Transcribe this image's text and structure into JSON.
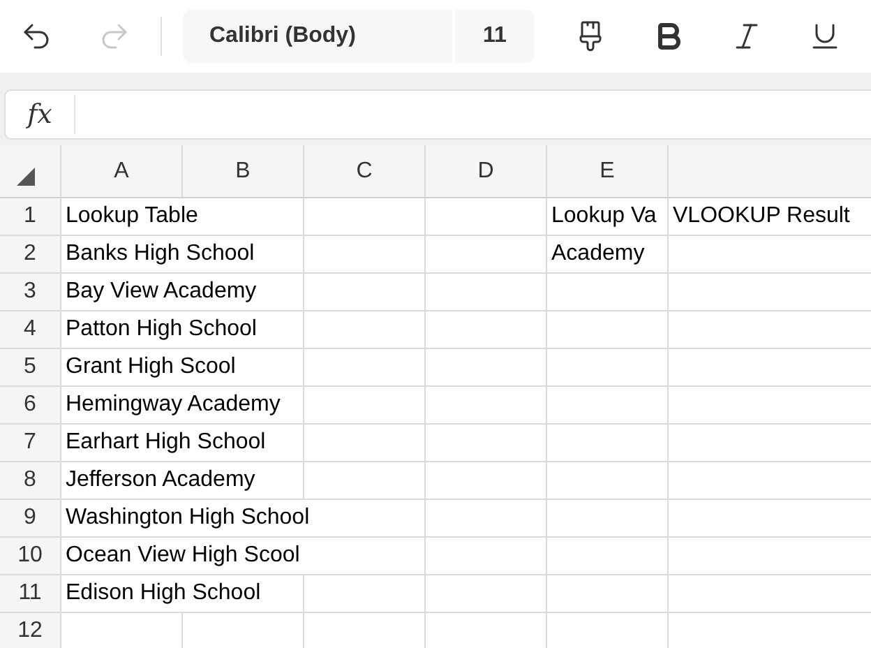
{
  "toolbar": {
    "undo": {
      "disabled": false
    },
    "redo": {
      "disabled": true
    },
    "font_name": "Calibri (Body)",
    "font_size": "11"
  },
  "formula_bar": {
    "label": "fx"
  },
  "columns": [
    "A",
    "B",
    "C",
    "D",
    "E"
  ],
  "rows": [
    {
      "row": "1",
      "A": "Lookup Table",
      "E": "Lookup Va",
      "column_6": "VLOOKUP Result"
    },
    {
      "row": "2",
      "A": "Banks High School",
      "E": "Academy"
    },
    {
      "row": "3",
      "A": "Bay View Academy"
    },
    {
      "row": "4",
      "A": "Patton High School"
    },
    {
      "row": "5",
      "A": "Grant High Scool"
    },
    {
      "row": "6",
      "A": "Hemingway Academy"
    },
    {
      "row": "7",
      "A": "Earhart High School"
    },
    {
      "row": "8",
      "A": "Jefferson Academy"
    },
    {
      "row": "9",
      "A": "Washington High School"
    },
    {
      "row": "10",
      "A": "Ocean View High Scool"
    },
    {
      "row": "11",
      "A": "Edison High School"
    },
    {
      "row": "12"
    }
  ]
}
